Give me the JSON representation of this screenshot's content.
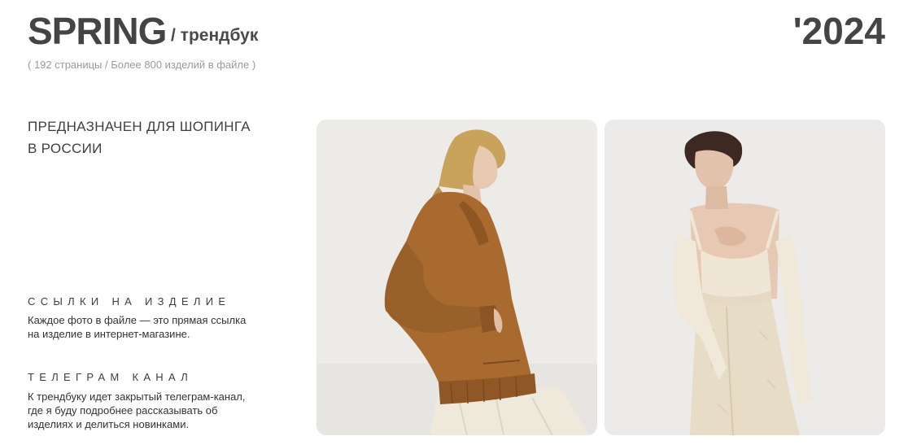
{
  "header": {
    "title": "SPRING",
    "subtitle": "/ трендбук",
    "year": "'2024",
    "meta": "( 192 страницы / Более 800 изделий в файле )"
  },
  "purpose": {
    "line1": "ПРЕДНАЗНАЧЕН ДЛЯ ШОПИНГА",
    "line2": "В РОССИИ"
  },
  "sections": [
    {
      "heading": "ССЫЛКИ НА ИЗДЕЛИЕ",
      "body_line1": "Каждое фото в файле — это прямая ссылка",
      "body_line2": "на изделие в интернет-магазине."
    },
    {
      "heading": "ТЕЛЕГРАМ КАНАЛ",
      "body_line1": "К трендбуку идет закрытый телеграм-канал,",
      "body_line2": "где я буду подробнее рассказывать об",
      "body_line3": "изделиях и делиться новинками."
    }
  ],
  "photos": [
    {
      "icon": "photo-suede-jacket",
      "background": "#ecebe8"
    },
    {
      "icon": "photo-off-shoulder-top",
      "background": "#ecebe9"
    }
  ]
}
